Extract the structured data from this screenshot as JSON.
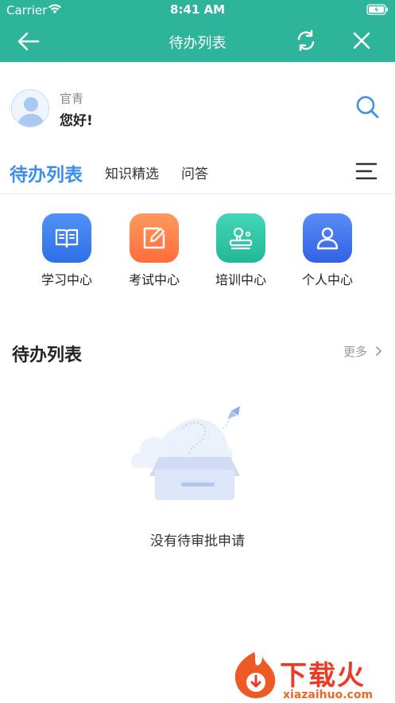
{
  "status_bar": {
    "carrier": "Carrier",
    "time": "8:41 AM"
  },
  "nav": {
    "title": "待办列表"
  },
  "user": {
    "name": "官青",
    "greeting": "您好!"
  },
  "tabs": {
    "active": "待办列表",
    "items": [
      "知识精选",
      "问答"
    ]
  },
  "shortcuts": [
    {
      "label": "学习中心",
      "icon": "book-icon",
      "color": "#3a7ff0"
    },
    {
      "label": "考试中心",
      "icon": "edit-icon",
      "color": "#ff7a45"
    },
    {
      "label": "培训中心",
      "icon": "stamp-icon",
      "color": "#2ec9a8"
    },
    {
      "label": "个人中心",
      "icon": "person-icon",
      "color": "#3f74ef"
    }
  ],
  "section": {
    "title": "待办列表",
    "more": "更多"
  },
  "empty_state": {
    "text": "没有待审批申请"
  },
  "watermark": {
    "main": "下载火",
    "sub": "xiazaihuo.com"
  },
  "colors": {
    "primary": "#2db49a",
    "accent_blue": "#3a8ef0"
  }
}
